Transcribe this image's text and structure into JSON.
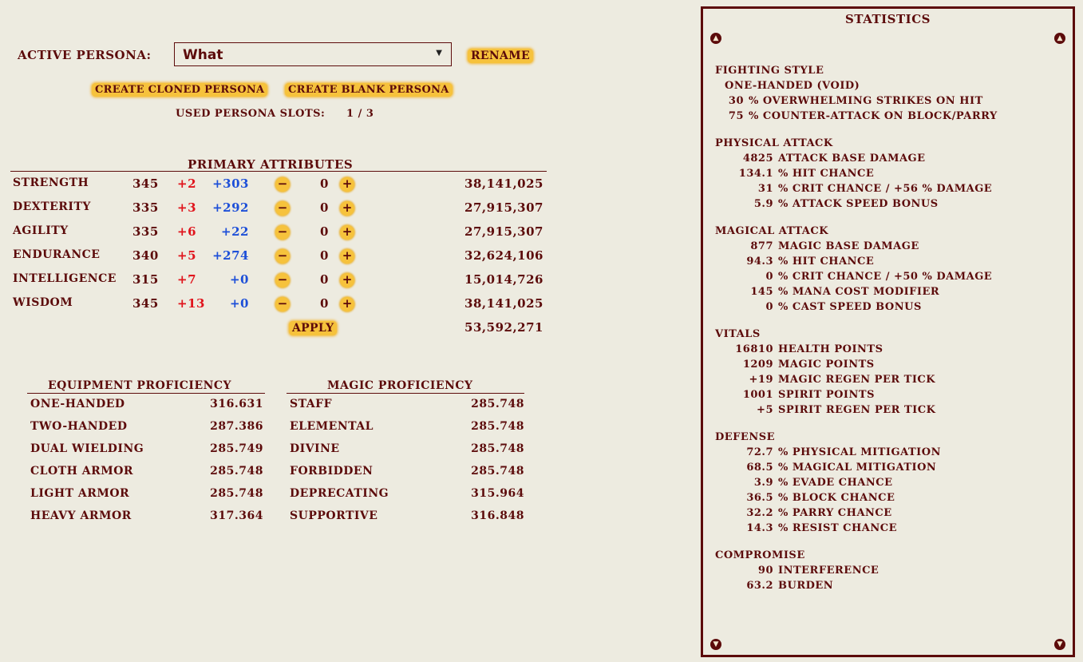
{
  "persona": {
    "label": "Active Persona:",
    "selected": "What",
    "rename_label": "Rename",
    "clone_label": "Create Cloned Persona",
    "blank_label": "Create Blank Persona",
    "slots_label": "Used Persona Slots:",
    "slots_value": "1 / 3"
  },
  "primary": {
    "title": "Primary Attributes",
    "rows": [
      {
        "name": "Strength",
        "base": "345",
        "bonus": "+2",
        "equip": "+303",
        "alloc": "0",
        "exp": "38,141,025"
      },
      {
        "name": "Dexterity",
        "base": "335",
        "bonus": "+3",
        "equip": "+292",
        "alloc": "0",
        "exp": "27,915,307"
      },
      {
        "name": "Agility",
        "base": "335",
        "bonus": "+6",
        "equip": "+22",
        "alloc": "0",
        "exp": "27,915,307"
      },
      {
        "name": "Endurance",
        "base": "340",
        "bonus": "+5",
        "equip": "+274",
        "alloc": "0",
        "exp": "32,624,106"
      },
      {
        "name": "Intelligence",
        "base": "315",
        "bonus": "+7",
        "equip": "+0",
        "alloc": "0",
        "exp": "15,014,726"
      },
      {
        "name": "Wisdom",
        "base": "345",
        "bonus": "+13",
        "equip": "+0",
        "alloc": "0",
        "exp": "38,141,025"
      }
    ],
    "minus_glyph": "−",
    "plus_glyph": "+",
    "apply_label": "Apply",
    "total_exp": "53,592,271"
  },
  "equipment": {
    "title": "Equipment Proficiency",
    "rows": [
      {
        "name": "One-handed",
        "value": "316.631"
      },
      {
        "name": "Two-handed",
        "value": "287.386"
      },
      {
        "name": "Dual wielding",
        "value": "285.749"
      },
      {
        "name": "Cloth armor",
        "value": "285.748"
      },
      {
        "name": "Light armor",
        "value": "285.748"
      },
      {
        "name": "Heavy armor",
        "value": "317.364"
      }
    ]
  },
  "magic": {
    "title": "Magic Proficiency",
    "rows": [
      {
        "name": "Staff",
        "value": "285.748"
      },
      {
        "name": "Elemental",
        "value": "285.748"
      },
      {
        "name": "Divine",
        "value": "285.748"
      },
      {
        "name": "Forbidden",
        "value": "285.748"
      },
      {
        "name": "Deprecating",
        "value": "315.964"
      },
      {
        "name": "Supportive",
        "value": "316.848"
      }
    ]
  },
  "stats": {
    "title": "Statistics",
    "sections": [
      {
        "title": "Fighting Style",
        "lines": [
          {
            "num": "",
            "text": "One-handed (Void)"
          },
          {
            "num": "30",
            "text": "% Overwhelming Strikes on hit"
          },
          {
            "num": "75",
            "text": "% Counter-Attack on block/parry"
          }
        ]
      },
      {
        "title": "Physical Attack",
        "lines": [
          {
            "num": "4825",
            "text": "attack base damage"
          },
          {
            "num": "134.1",
            "text": "% hit chance"
          },
          {
            "num": "31",
            "text": "% crit chance / +56 % damage"
          },
          {
            "num": "5.9",
            "text": "% attack speed bonus"
          }
        ]
      },
      {
        "title": "Magical Attack",
        "lines": [
          {
            "num": "877",
            "text": "magic base damage"
          },
          {
            "num": "94.3",
            "text": "% hit chance"
          },
          {
            "num": "0",
            "text": "% crit chance / +50 % damage"
          },
          {
            "num": "145",
            "text": "% mana cost modifier"
          },
          {
            "num": "0",
            "text": "% cast speed bonus"
          }
        ]
      },
      {
        "title": "Vitals",
        "lines": [
          {
            "num": "16810",
            "text": "health points"
          },
          {
            "num": "1209",
            "text": "magic points"
          },
          {
            "num": "+19",
            "text": "magic regen per tick"
          },
          {
            "num": "1001",
            "text": "spirit points"
          },
          {
            "num": "+5",
            "text": "spirit regen per tick"
          }
        ]
      },
      {
        "title": "Defense",
        "lines": [
          {
            "num": "72.7",
            "text": "% physical mitigation"
          },
          {
            "num": "68.5",
            "text": "% magical mitigation"
          },
          {
            "num": "3.9",
            "text": "% evade chance"
          },
          {
            "num": "36.5",
            "text": "% block chance"
          },
          {
            "num": "32.2",
            "text": "% parry chance"
          },
          {
            "num": "14.3",
            "text": "% resist chance"
          }
        ]
      },
      {
        "title": "Compromise",
        "lines": [
          {
            "num": "90",
            "text": "interference"
          },
          {
            "num": "63.2",
            "text": "burden"
          }
        ]
      }
    ]
  }
}
